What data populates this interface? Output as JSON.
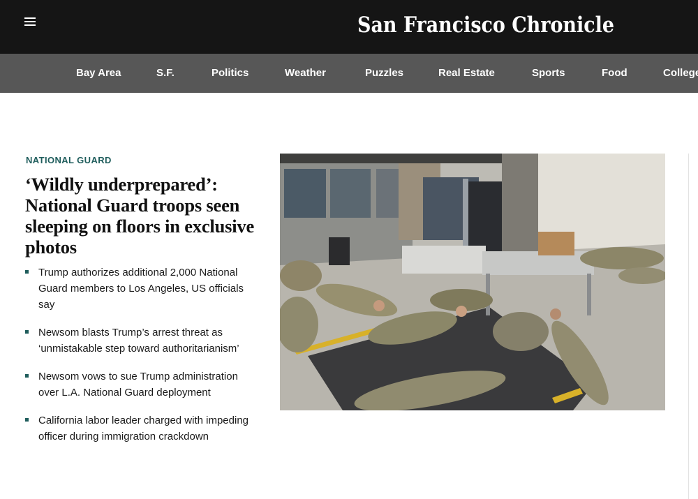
{
  "header": {
    "menu_icon": "hamburger-menu-icon",
    "logo_text": "San Francisco Chronicle"
  },
  "nav": {
    "items": [
      "Bay Area",
      "S.F.",
      "Politics",
      "Weather",
      "Puzzles",
      "Real Estate",
      "Sports",
      "Food",
      "College"
    ]
  },
  "story": {
    "section": "NATIONAL GUARD",
    "headline": "‘Wildly underprepared’: National Guard troops seen sleeping on floors in exclusive photos",
    "image_alt": "National Guard troops sleeping on the floor of a loading dock",
    "related": [
      "Trump authorizes additional 2,000 National Guard members to Los Angeles, US officials say",
      "Newsom blasts Trump’s arrest threat as ‘unmistakable step toward authoritarianism’",
      "Newsom vows to sue Trump administration over L.A. National Guard deployment",
      "California labor leader charged with impeding officer during immigration crackdown"
    ]
  },
  "colors": {
    "topbar": "#151515",
    "navbar": "#575757",
    "accent": "#1f5d5c",
    "text": "#111111"
  }
}
